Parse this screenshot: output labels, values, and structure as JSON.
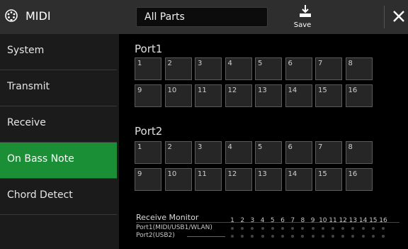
{
  "header": {
    "title": "MIDI",
    "part_select": "All Parts",
    "save_label": "Save"
  },
  "sidebar": {
    "items": [
      {
        "label": "System",
        "active": false
      },
      {
        "label": "Transmit",
        "active": false
      },
      {
        "label": "Receive",
        "active": false
      },
      {
        "label": "On Bass Note",
        "active": true
      },
      {
        "label": "Chord Detect",
        "active": false
      }
    ]
  },
  "ports": [
    {
      "label": "Port1",
      "channels": [
        "1",
        "2",
        "3",
        "4",
        "5",
        "6",
        "7",
        "8",
        "9",
        "10",
        "11",
        "12",
        "13",
        "14",
        "15",
        "16"
      ]
    },
    {
      "label": "Port2",
      "channels": [
        "1",
        "2",
        "3",
        "4",
        "5",
        "6",
        "7",
        "8",
        "9",
        "10",
        "11",
        "12",
        "13",
        "14",
        "15",
        "16"
      ]
    }
  ],
  "monitor": {
    "title": "Receive Monitor",
    "channel_numbers": [
      "1",
      "2",
      "3",
      "4",
      "5",
      "6",
      "7",
      "8",
      "9",
      "10",
      "11",
      "12",
      "13",
      "14",
      "15",
      "16"
    ],
    "port_labels": [
      "Port1(MIDI/USB1/WLAN)",
      "Port2(USB2)"
    ]
  },
  "colors": {
    "accent": "#1b8f35",
    "header_bg": "#2e2e2e",
    "sidebar_bg": "#1b1b1b"
  }
}
